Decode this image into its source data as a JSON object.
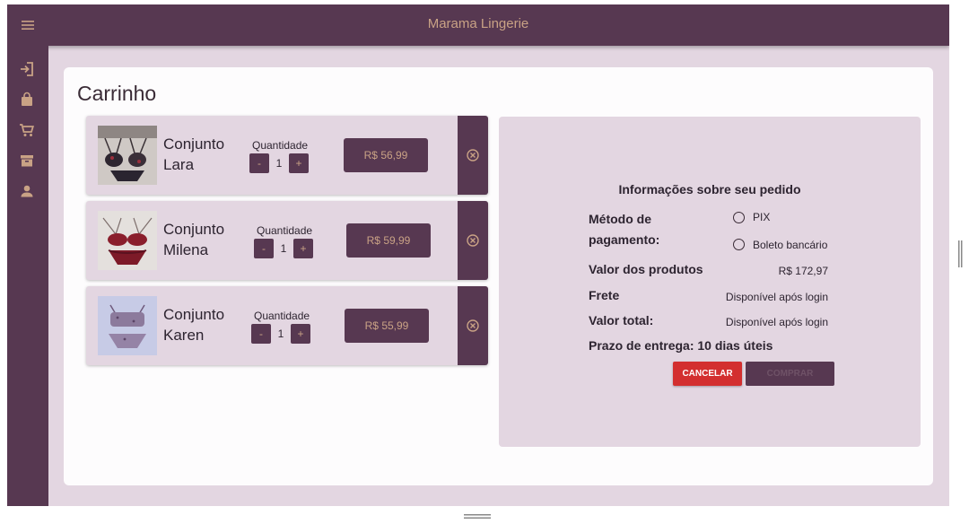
{
  "header": {
    "title": "Marama Lingerie",
    "menu_icon": "menu-icon"
  },
  "sidebar": {
    "items": [
      {
        "icon": "login-icon"
      },
      {
        "icon": "shopping-bag-icon"
      },
      {
        "icon": "shopping-cart-icon"
      },
      {
        "icon": "archive-icon"
      },
      {
        "icon": "person-icon"
      }
    ]
  },
  "page": {
    "title": "Carrinho"
  },
  "cart": {
    "quantity_label": "Quantidade",
    "minus_label": "-",
    "plus_label": "+",
    "items": [
      {
        "name": "Conjunto Lara",
        "quantity": "1",
        "price": "R$ 56,99"
      },
      {
        "name": "Conjunto Milena",
        "quantity": "1",
        "price": "R$ 59,99"
      },
      {
        "name": "Conjunto Karen",
        "quantity": "1",
        "price": "R$ 55,99"
      }
    ]
  },
  "summary": {
    "title": "Informações sobre seu pedido",
    "payment_label": "Método de pagamento:",
    "payment_options": [
      "PIX",
      "Boleto bancário"
    ],
    "products_label": "Valor dos produtos",
    "products_value": "R$ 172,97",
    "shipping_label": "Frete",
    "shipping_value": "Disponível após login",
    "total_label": "Valor total:",
    "total_value": "Disponível após login",
    "delivery_label": "Prazo de entrega: 10 dias úteis",
    "cancel_label": "CANCELAR",
    "buy_label": "COMPRAR"
  },
  "colors": {
    "primary": "#573851",
    "accent_text": "#c9a285",
    "background": "#e3d6e1",
    "danger": "#d32f2f"
  }
}
